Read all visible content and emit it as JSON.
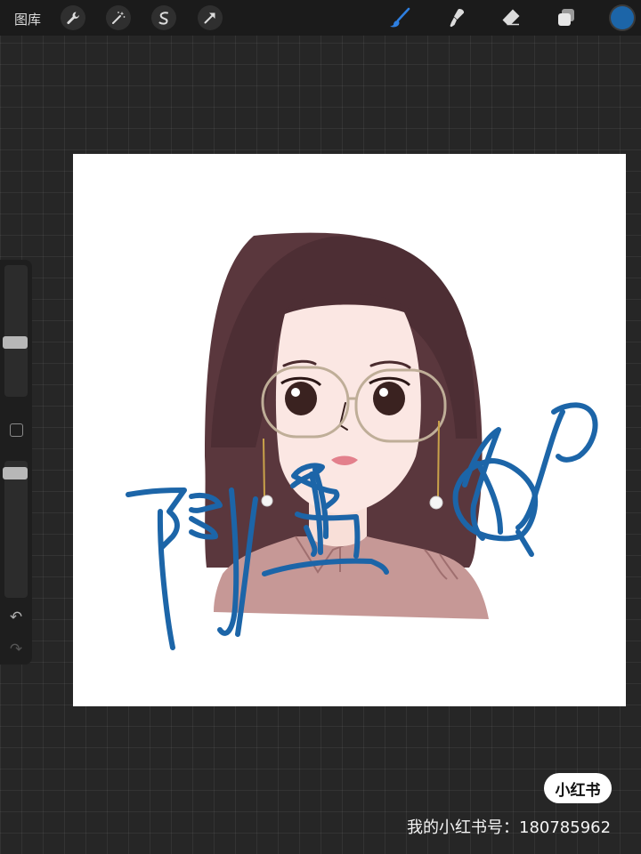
{
  "toolbar": {
    "gallery_label": "图库",
    "left_icons": [
      "wrench-icon",
      "magic-wand-icon",
      "selection-icon",
      "transform-arrow-icon"
    ],
    "right_icons": [
      "brush-icon",
      "smudge-icon",
      "eraser-icon",
      "layers-icon"
    ],
    "active_tool": "brush",
    "current_color": "#1c65a8"
  },
  "sidebar": {
    "brush_size_level": 0.4,
    "opacity_level": 0.05,
    "undo_icon": "↶",
    "redo_icon": "↷"
  },
  "canvas": {
    "background": "#ffffff",
    "stroke_color": "#1c65a8"
  },
  "watermark": {
    "badge": "小红书",
    "text": "我的小红书号：180785962"
  }
}
